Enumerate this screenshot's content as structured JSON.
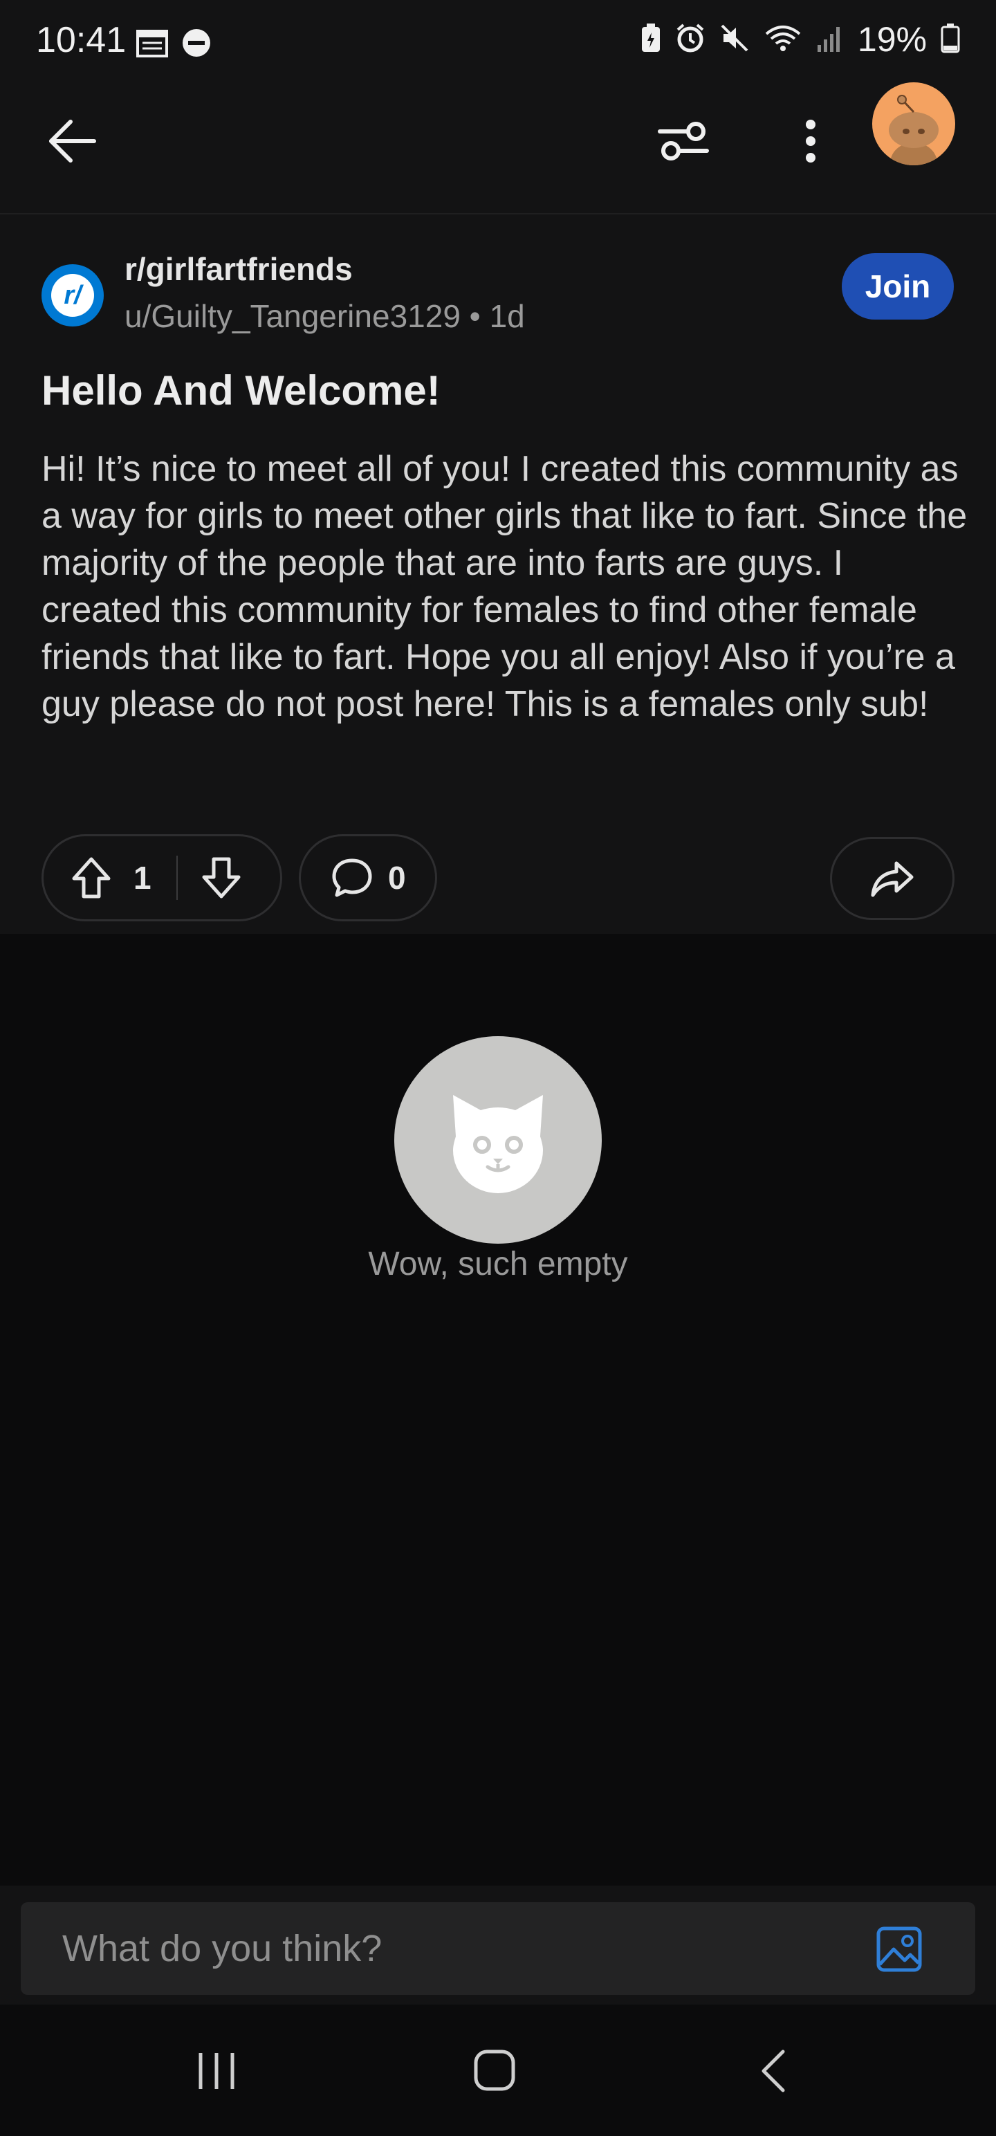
{
  "status_bar": {
    "time": "10:41",
    "battery": "19%",
    "icons": [
      "calendar-icon",
      "dnd-icon",
      "battery-saver-icon",
      "alarm-icon",
      "mute-icon",
      "wifi-icon",
      "signal-icon",
      "battery-icon"
    ]
  },
  "app_bar": {
    "icons": [
      "back-arrow-icon",
      "filter-icon",
      "more-options-icon",
      "user-avatar"
    ]
  },
  "post": {
    "community": "r/girlfartfriends",
    "community_avatar_text": "r/",
    "meta": "u/Guilty_Tangerine3129 • 1d",
    "join_label": "Join",
    "title": "Hello And Welcome!",
    "body": "Hi! It’s nice to meet all of you! I created this community as a way for girls to meet other girls that like to fart. Since the majority of the people that are into farts are guys. I created this community for females to find other female friends that like to fart. Hope you all enjoy! Also if you’re a guy please do not post here! This is a females only sub!",
    "upvotes": "1",
    "comments": "0"
  },
  "empty_state": {
    "text": "Wow, such empty"
  },
  "comment_bar": {
    "placeholder": "What do you think?"
  },
  "colors": {
    "background": "#0b0b0c",
    "card": "#131314",
    "join_button": "#1f4fb4",
    "accent_blue": "#2f7fd8",
    "avatar_orange": "#f4a261"
  }
}
